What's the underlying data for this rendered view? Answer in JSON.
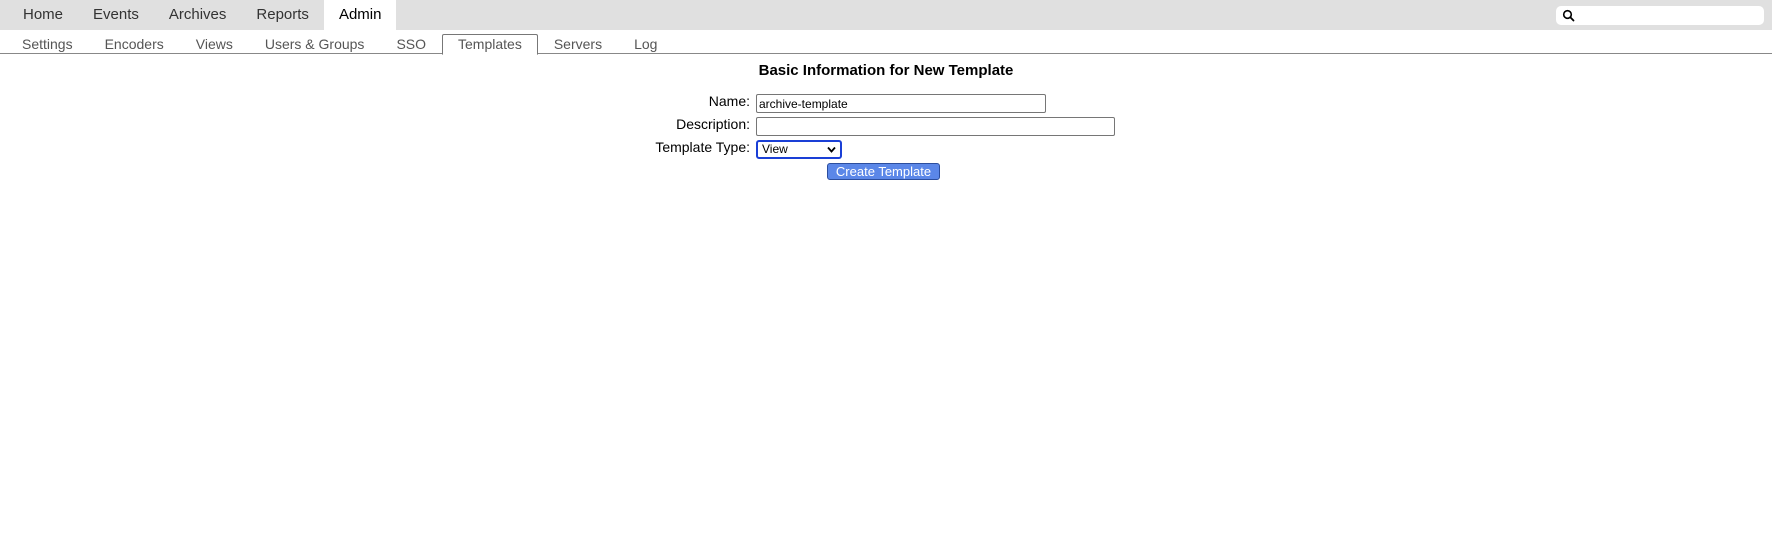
{
  "topnav": {
    "tabs": [
      {
        "label": "Home"
      },
      {
        "label": "Events"
      },
      {
        "label": "Archives"
      },
      {
        "label": "Reports"
      },
      {
        "label": "Admin"
      }
    ],
    "active": "Admin"
  },
  "search": {
    "icon": "search-icon",
    "placeholder": ""
  },
  "subnav": {
    "tabs": [
      {
        "label": "Settings"
      },
      {
        "label": "Encoders"
      },
      {
        "label": "Views"
      },
      {
        "label": "Users & Groups"
      },
      {
        "label": "SSO"
      },
      {
        "label": "Templates"
      },
      {
        "label": "Servers"
      },
      {
        "label": "Log"
      }
    ],
    "active": "Templates"
  },
  "form": {
    "heading": "Basic Information for New Template",
    "name_label": "Name:",
    "name_value": "archive-template",
    "description_label": "Description:",
    "description_value": "",
    "type_label": "Template Type:",
    "type_value": "View",
    "submit_label": "Create Template"
  },
  "colors": {
    "topbar_bg": "#e0e0e0",
    "button_bg": "#5b87e8",
    "select_focus": "#1a3fd6"
  }
}
